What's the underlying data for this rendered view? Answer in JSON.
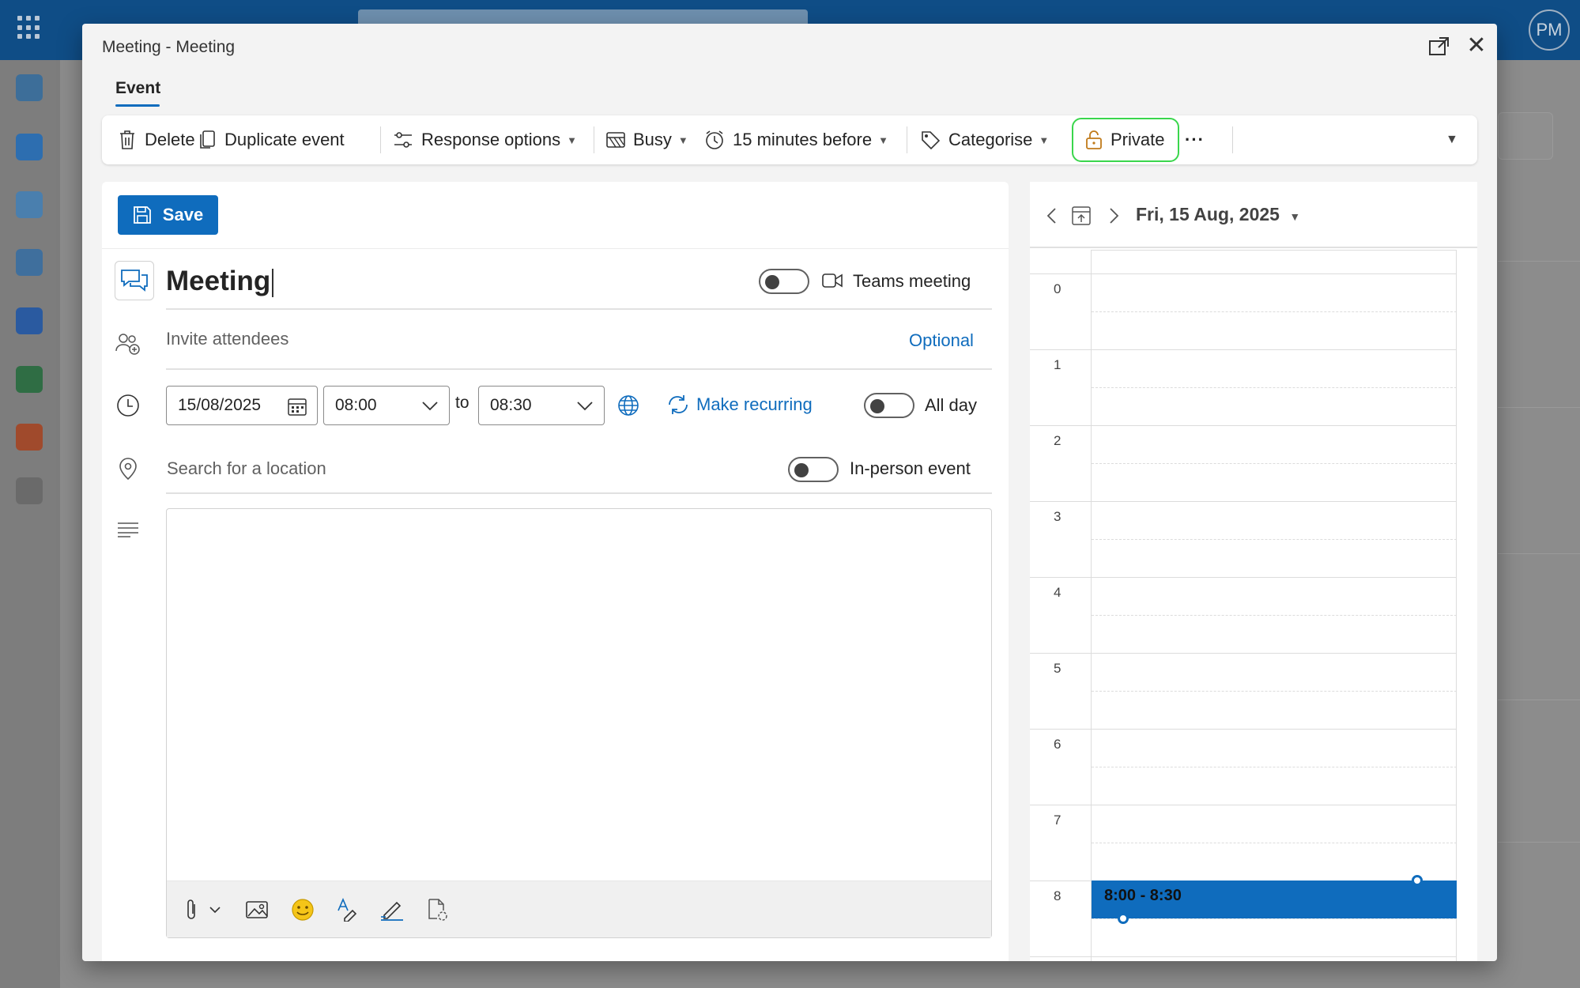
{
  "background": {
    "avatar_initials": "PM"
  },
  "dialog": {
    "title": "Meeting - Meeting",
    "tab": "Event"
  },
  "ribbon": {
    "delete": "Delete",
    "duplicate": "Duplicate event",
    "response_options": "Response options",
    "busy": "Busy",
    "reminder": "15 minutes before",
    "categorise": "Categorise",
    "private": "Private",
    "more": "···"
  },
  "form": {
    "save_label": "Save",
    "title_value": "Meeting",
    "teams_meeting_label": "Teams meeting",
    "attendees_placeholder": "Invite attendees",
    "optional_label": "Optional",
    "start_date": "15/08/2025",
    "start_time": "08:00",
    "to_label": "to",
    "end_time": "08:30",
    "make_recurring": "Make recurring",
    "all_day_label": "All day",
    "location_placeholder": "Search for a location",
    "in_person_label": "In-person event"
  },
  "calendar": {
    "date_label": "Fri, 15 Aug, 2025",
    "hours": [
      "0",
      "1",
      "2",
      "3",
      "4",
      "5",
      "6",
      "7",
      "8"
    ],
    "event_label": "8:00 - 8:30"
  },
  "colors": {
    "accent": "#0f6cbd",
    "highlight": "#3ad64c"
  }
}
